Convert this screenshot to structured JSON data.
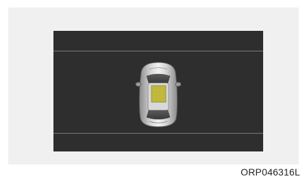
{
  "figure": {
    "code": "ORP046316L"
  },
  "display": {
    "background_color": "#2e2e2e",
    "lane_line_color": "#7a7a7a",
    "vehicle_icon": "car-top-view-icon",
    "highlight_icon": "sunroof-highlight-icon",
    "highlight_color": "#c8c040"
  }
}
